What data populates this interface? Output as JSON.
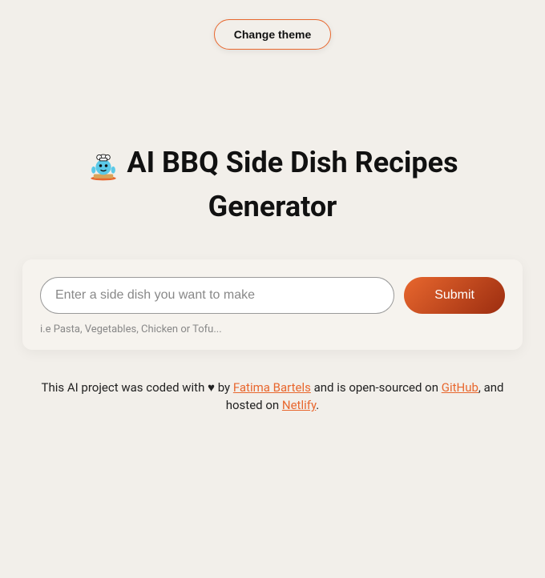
{
  "header": {
    "theme_button_label": "Change theme"
  },
  "hero": {
    "title": "AI BBQ Side Dish Recipes Generator",
    "icon_name": "chef-icon"
  },
  "form": {
    "input_placeholder": "Enter a side dish you want to make",
    "input_value": "",
    "submit_label": "Submit",
    "hint": "i.e Pasta, Vegetables, Chicken or Tofu..."
  },
  "footer": {
    "part1": "This AI project was coded with ",
    "heart": "♥",
    "part2": " by ",
    "author_name": "Fatima Bartels",
    "part3": " and is open-sourced on ",
    "github_label": "GitHub",
    "part4": ", and hosted on ",
    "netlify_label": "Netlify",
    "part5": "."
  }
}
